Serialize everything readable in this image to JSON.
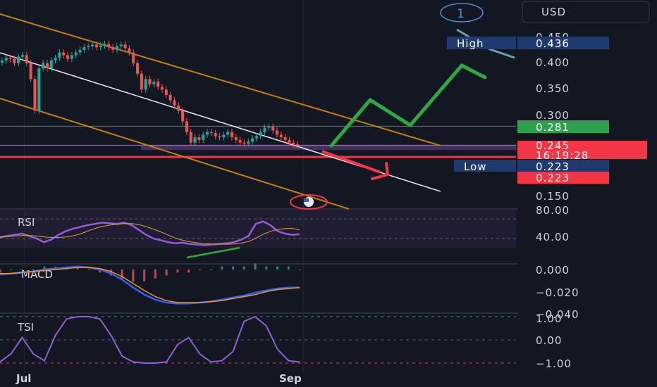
{
  "currency": "USD",
  "alert_number": "1",
  "colors": {
    "bg": "#131722",
    "up": "#26a69a",
    "down": "#ef5350",
    "channel": "#c77d14",
    "trend": "#e8e8e8",
    "green_line": "#2e9e4f",
    "red_line": "#f23645",
    "rsi": "#9b59d9",
    "macd": "#2962ff",
    "signal": "#f7931a",
    "tsi": "#8e5fd6",
    "arrow_up": "#2ea843",
    "arrow_down": "#f23645",
    "zone": "#7b4f9b"
  },
  "price_axis": {
    "ticks": [
      "0.450",
      "0.400",
      "0.350",
      "0.300",
      "0.150"
    ]
  },
  "badges": {
    "high_label": "High",
    "high_value": "0.436",
    "last_value": "0.281",
    "current_price": "0.245",
    "countdown": "16:19:28",
    "low_label": "Low",
    "low_value": "0.223",
    "low_value_red": "0.223"
  },
  "panes": {
    "rsi_label": "RSI",
    "rsi_ticks": [
      "80.00",
      "40.00"
    ],
    "macd_label": "MACD",
    "macd_ticks": [
      "0.000",
      "−0.020",
      "−0.040"
    ],
    "tsi_label": "TSI",
    "tsi_ticks": [
      "1.00",
      "0.00",
      "−1.00"
    ]
  },
  "time_axis": {
    "labels": [
      "Jul",
      "Sep"
    ]
  },
  "chart_data": {
    "type": "line",
    "title": "",
    "xlabel": "",
    "ylabel": "",
    "ylim": [
      0.13,
      0.47
    ],
    "x_labels": [
      "Jul",
      "Sep"
    ],
    "price": {
      "close": [
        0.405,
        0.41,
        0.408,
        0.4,
        0.412,
        0.415,
        0.4,
        0.37,
        0.31,
        0.39,
        0.4,
        0.39,
        0.405,
        0.41,
        0.42,
        0.415,
        0.408,
        0.415,
        0.42,
        0.425,
        0.43,
        0.432,
        0.435,
        0.43,
        0.433,
        0.436,
        0.43,
        0.425,
        0.432,
        0.435,
        0.428,
        0.42,
        0.4,
        0.38,
        0.35,
        0.37,
        0.36,
        0.365,
        0.355,
        0.35,
        0.34,
        0.33,
        0.32,
        0.31,
        0.29,
        0.27,
        0.25,
        0.26,
        0.255,
        0.265,
        0.27,
        0.268,
        0.262,
        0.26,
        0.265,
        0.27,
        0.26,
        0.255,
        0.25,
        0.248,
        0.252,
        0.258,
        0.262,
        0.27,
        0.278,
        0.28,
        0.273,
        0.265,
        0.26,
        0.255,
        0.25,
        0.247,
        0.245
      ],
      "high": 0.436,
      "low": 0.223,
      "last": 0.245
    },
    "levels": {
      "green_horizontal": 0.281,
      "red_support": 0.223,
      "purple_zone": [
        0.236,
        0.245
      ]
    },
    "rsi": {
      "range": [
        0,
        100
      ],
      "levels": [
        80,
        40
      ],
      "values": [
        38,
        40,
        42,
        44,
        40,
        36,
        30,
        34,
        42,
        48,
        52,
        55,
        58,
        60,
        62,
        61,
        60,
        62,
        58,
        50,
        42,
        36,
        33,
        30,
        28,
        29,
        27,
        26,
        25,
        26,
        27,
        28,
        30,
        34,
        40,
        60,
        64,
        58,
        48,
        44,
        42,
        43
      ]
    },
    "macd": {
      "range": [
        -0.045,
        0.01
      ],
      "macd_line": [
        -0.005,
        -0.004,
        -0.003,
        -0.002,
        0.0,
        0.001,
        0.002,
        0.003,
        0.002,
        0.0,
        -0.004,
        -0.01,
        -0.018,
        -0.025,
        -0.03,
        -0.033,
        -0.034,
        -0.034,
        -0.033,
        -0.032,
        -0.03,
        -0.028,
        -0.026,
        -0.023,
        -0.021,
        -0.019,
        -0.018,
        -0.018
      ],
      "signal_line": [
        -0.004,
        -0.004,
        -0.003,
        -0.002,
        -0.001,
        0.0,
        0.001,
        0.002,
        0.002,
        0.001,
        -0.002,
        -0.007,
        -0.014,
        -0.021,
        -0.027,
        -0.031,
        -0.033,
        -0.033,
        -0.033,
        -0.032,
        -0.031,
        -0.029,
        -0.027,
        -0.025,
        -0.022,
        -0.02,
        -0.019,
        -0.018
      ]
    },
    "tsi": {
      "range": [
        -1,
        1
      ],
      "values": [
        -0.95,
        -0.6,
        0.1,
        -0.6,
        -0.9,
        0.2,
        0.9,
        1.0,
        1.0,
        0.9,
        0.2,
        -0.7,
        -0.95,
        -1.0,
        -1.0,
        -0.95,
        -0.2,
        0.1,
        -0.6,
        -0.95,
        -0.9,
        -0.5,
        0.8,
        1.0,
        0.6,
        -0.4,
        -0.9,
        -0.95
      ]
    }
  }
}
